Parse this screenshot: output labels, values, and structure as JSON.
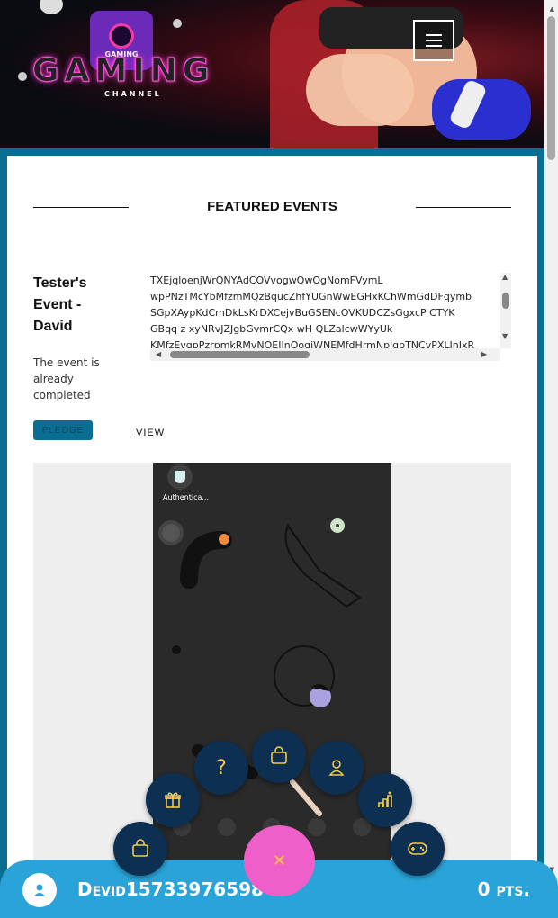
{
  "header": {
    "logo_badge_text": "GAMING",
    "brand": "GAMING",
    "brand_sub": "CHANNEL",
    "menu_icon": "hamburger-icon"
  },
  "featured": {
    "title": "FEATURED EVENTS"
  },
  "event": {
    "title": "Tester's Event - David",
    "status": "The event is already completed",
    "description_lines": [
      "TXEjqloenjWrQNYAdCOVvogwQwOgNomFVymL",
      "wpPNzTMcYbMfzmMQzBqucZhfYUGnWwEGHxKChWmGdDFqymb",
      "SGpXAypKdCmDkLsKrDXCejvBuGSENcOVKUDCZsGgxcP CTYK",
      "GBqq z xyNRvJZJgbGvmrCQx wH QLZalcwWYyUk",
      "KMfzEvgpPzrpmkRMvNOEIJnOogiWNEMfdHrmNplgpTNCvPXLInIxR"
    ],
    "pledge_label": "PLEDGE",
    "view_label": "VIEW",
    "screenshot": {
      "app_label": "Authentica..."
    }
  },
  "fab_menu": {
    "main_icon": "close-icon",
    "items": [
      "bag-icon",
      "gift-icon",
      "help-icon",
      "bag-icon",
      "user-icon",
      "leaderboard-icon",
      "gamepad-icon"
    ]
  },
  "footer": {
    "username": "Devid15733976598",
    "points": "0 pts."
  },
  "colors": {
    "teal": "#0a6e93",
    "footer_blue": "#2aa4d8",
    "fab_navy": "#0c2f52",
    "fab_pink": "#ee5fc9",
    "icon_yellow": "#f7c948"
  }
}
